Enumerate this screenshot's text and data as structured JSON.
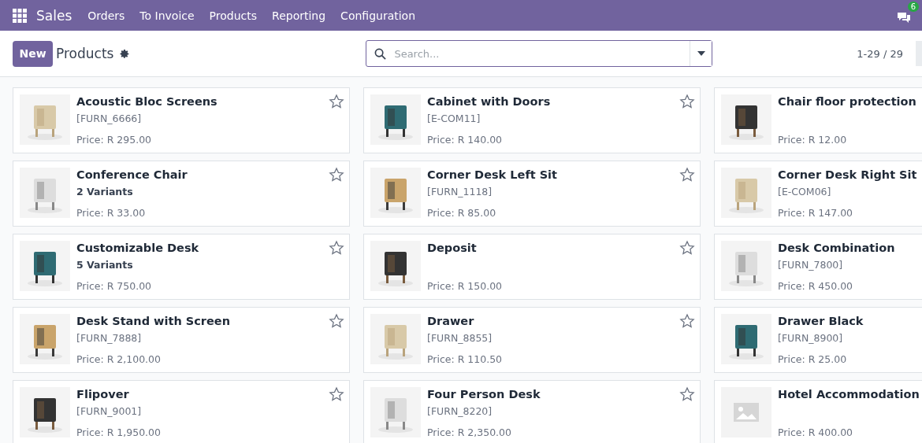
{
  "navbar": {
    "app": "Sales",
    "menu": [
      "Orders",
      "To Invoice",
      "Products",
      "Reporting",
      "Configuration"
    ],
    "messages_badge": "6"
  },
  "control_panel": {
    "new_button": "New",
    "title": "Products",
    "search": {
      "placeholder": "Search..."
    },
    "pager": "1-29 / 29"
  },
  "products": [
    [
      {
        "name": "Acoustic Bloc Screens",
        "code": "[FURN_6666]",
        "price": "Price: R 295.00",
        "kind": "picture",
        "favorite": false
      },
      {
        "name": "Cabinet with Doors",
        "code": "[E-COM11]",
        "price": "Price: R 140.00",
        "kind": "picture",
        "favorite": false
      },
      {
        "name": "Chair floor protection",
        "price": "Price: R 12.00",
        "kind": "picture"
      }
    ],
    [
      {
        "name": "Conference Chair",
        "variants": "2 Variants",
        "price": "Price: R 33.00",
        "kind": "picture",
        "favorite": false
      },
      {
        "name": "Corner Desk Left Sit",
        "code": "[FURN_1118]",
        "price": "Price: R 85.00",
        "kind": "picture",
        "favorite": false
      },
      {
        "name": "Corner Desk Right Sit",
        "code": "[E-COM06]",
        "price": "Price: R 147.00",
        "kind": "picture"
      }
    ],
    [
      {
        "name": "Customizable Desk",
        "variants": "5 Variants",
        "price": "Price: R 750.00",
        "kind": "picture",
        "favorite": false
      },
      {
        "name": "Deposit",
        "price": "Price: R 150.00",
        "kind": "picture",
        "favorite": false
      },
      {
        "name": "Desk Combination",
        "code": "[FURN_7800]",
        "price": "Price: R 450.00",
        "kind": "picture"
      }
    ],
    [
      {
        "name": "Desk Stand with Screen",
        "code": "[FURN_7888]",
        "price": "Price: R 2,100.00",
        "kind": "picture",
        "favorite": false
      },
      {
        "name": "Drawer",
        "code": "[FURN_8855]",
        "price": "Price: R 110.50",
        "kind": "picture",
        "favorite": false
      },
      {
        "name": "Drawer Black",
        "code": "[FURN_8900]",
        "price": "Price: R 25.00",
        "kind": "picture"
      }
    ],
    [
      {
        "name": "Flipover",
        "code": "[FURN_9001]",
        "price": "Price: R 1,950.00",
        "kind": "picture",
        "favorite": false
      },
      {
        "name": "Four Person Desk",
        "code": "[FURN_8220]",
        "price": "Price: R 2,350.00",
        "kind": "picture",
        "favorite": false
      },
      {
        "name": "Hotel Accommodation",
        "price": "Price: R 400.00",
        "kind": "placeholder"
      }
    ]
  ]
}
